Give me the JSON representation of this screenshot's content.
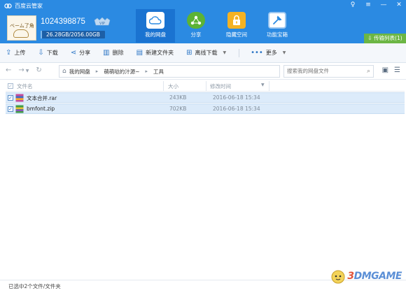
{
  "app": {
    "title": "百度云管家"
  },
  "window_controls": {
    "skin": "♀",
    "menu": "≡",
    "minimize": "—",
    "close": "✕"
  },
  "user": {
    "avatar_text": "ベーム了角",
    "id": "1024398875",
    "vip_label": "VIP",
    "quota_text": "26.28GB/2056.00GB",
    "quota_used_fraction": 0.0128
  },
  "nav_tabs": [
    {
      "label": "我的网盘",
      "icon": "cloud-icon",
      "active": true
    },
    {
      "label": "分享",
      "icon": "share-icon",
      "active": false
    },
    {
      "label": "隐藏空间",
      "icon": "lock-icon",
      "active": false
    },
    {
      "label": "功能宝箱",
      "icon": "toolbox-icon",
      "active": false
    }
  ],
  "transfer_list_label": "传输列表(1)",
  "toolbar": {
    "upload": "上传",
    "download": "下载",
    "share": "分享",
    "delete": "删除",
    "new_folder": "新建文件夹",
    "offline_download": "离线下载",
    "more": "更多"
  },
  "address": {
    "crumbs": [
      "我的网盘",
      "萌萌哒的汁源~",
      "工具"
    ]
  },
  "search": {
    "placeholder": "搜索我的网盘文件"
  },
  "list_columns": {
    "name": "文件名",
    "size": "大小",
    "modified": "修改时间"
  },
  "files": [
    {
      "name": "文本合并.rar",
      "size": "243KB",
      "modified": "2016-06-18 15:34",
      "type": "rar",
      "checked": true
    },
    {
      "name": "bmfont.zip",
      "size": "702KB",
      "modified": "2016-06-18 15:34",
      "type": "zip",
      "checked": true
    }
  ],
  "status_text": "已选中2个文件/文件夹",
  "watermark": {
    "prefix": "3",
    "text": "DMGAME"
  },
  "colors": {
    "brand_blue": "#2b8ae2",
    "active_tab": "#1a73d1",
    "transfer_green": "#6cb644",
    "selected_row": "#dcebfa"
  }
}
